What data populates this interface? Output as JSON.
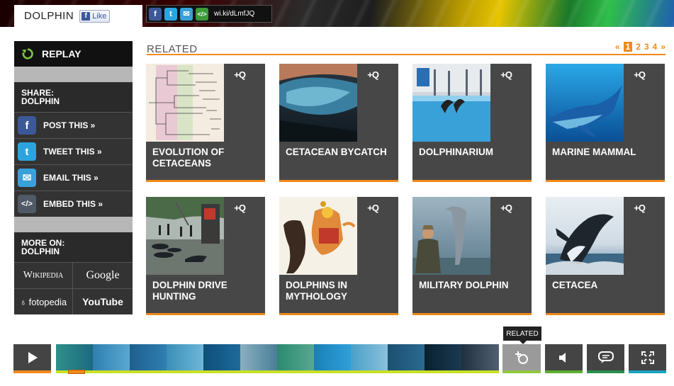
{
  "header": {
    "title": "DOLPHIN",
    "like_label": "Like",
    "short_link": "wi.ki/dLmfJQ"
  },
  "sidebar": {
    "replay_label": "REPLAY",
    "share_heading_line1": "SHARE:",
    "share_heading_line2": "DOLPHIN",
    "share_items": [
      {
        "label": "POST THIS »",
        "icon": "facebook-icon",
        "color": "#3b5998"
      },
      {
        "label": "TWEET THIS »",
        "icon": "twitter-icon",
        "color": "#2ba5e0"
      },
      {
        "label": "EMAIL THIS »",
        "icon": "email-icon",
        "color": "#3aa0d8"
      },
      {
        "label": "EMBED THIS »",
        "icon": "embed-icon",
        "color": "#505a66"
      }
    ],
    "more_heading_line1": "MORE ON:",
    "more_heading_line2": "DOLPHIN",
    "more_links": [
      "Wikipedia",
      "Google",
      "fotopedia",
      "YouTube"
    ]
  },
  "related": {
    "title": "RELATED",
    "pager": {
      "prev": "«",
      "pages": [
        "1",
        "2",
        "3",
        "4"
      ],
      "current": "1",
      "next": "»"
    },
    "items": [
      {
        "label": "EVOLUTION OF CETACEANS",
        "thumb": "phylogenetic-tree"
      },
      {
        "label": "CETACEAN BYCATCH",
        "thumb": "bycatch-whale"
      },
      {
        "label": "DOLPHINARIUM",
        "thumb": "dolphinarium-show"
      },
      {
        "label": "MARINE MAMMAL",
        "thumb": "blue-whale"
      },
      {
        "label": "DOLPHIN DRIVE HUNTING",
        "thumb": "drive-hunt-beach"
      },
      {
        "label": "DOLPHINS IN MYTHOLOGY",
        "thumb": "mythology-painting"
      },
      {
        "label": "MILITARY DOLPHIN",
        "thumb": "military-dolphin-jump"
      },
      {
        "label": "CETACEA",
        "thumb": "breaching-whale"
      }
    ],
    "badge_text": "+Q"
  },
  "controls": {
    "tooltip": "RELATED",
    "scrub_position_fraction": 0.03
  },
  "colors": {
    "accent_orange": "#f08a1c",
    "card_bg": "#474747",
    "sidebar_bg": "#333333"
  }
}
